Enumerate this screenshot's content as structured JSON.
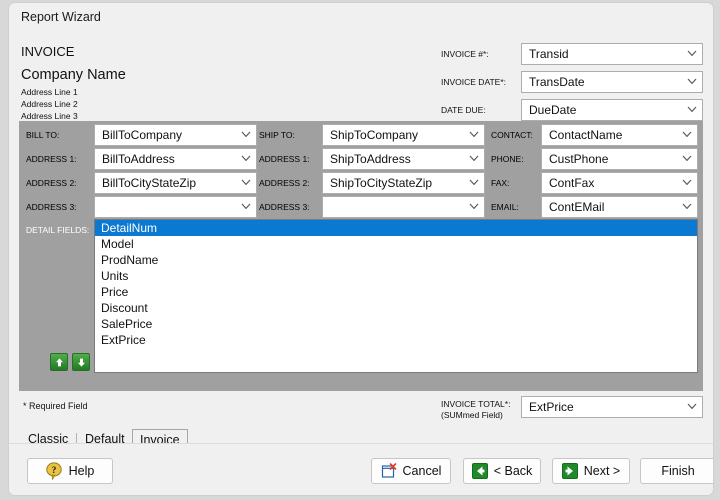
{
  "window": {
    "title": "Report Wizard"
  },
  "header": {
    "invoice_label": "INVOICE",
    "company_name": "Company Name",
    "address_line_1": "Address Line 1",
    "address_line_2": "Address Line 2",
    "address_line_3": "Address Line 3"
  },
  "top_fields": [
    {
      "label": "INVOICE #*:",
      "value": "Transid"
    },
    {
      "label": "INVOICE DATE*:",
      "value": "TransDate"
    },
    {
      "label": "DATE DUE:",
      "value": "DueDate"
    }
  ],
  "bill_to": [
    {
      "label": "BILL TO:",
      "value": "BillToCompany"
    },
    {
      "label": "ADDRESS 1:",
      "value": "BillToAddress"
    },
    {
      "label": "ADDRESS 2:",
      "value": "BillToCityStateZip"
    },
    {
      "label": "ADDRESS 3:",
      "value": ""
    }
  ],
  "ship_to": [
    {
      "label": "SHIP TO:",
      "value": "ShipToCompany"
    },
    {
      "label": "ADDRESS 1:",
      "value": "ShipToAddress"
    },
    {
      "label": "ADDRESS 2:",
      "value": "ShipToCityStateZip"
    },
    {
      "label": "ADDRESS 3:",
      "value": ""
    }
  ],
  "contact": [
    {
      "label": "CONTACT:",
      "value": "ContactName"
    },
    {
      "label": "PHONE:",
      "value": "CustPhone"
    },
    {
      "label": "FAX:",
      "value": "ContFax"
    },
    {
      "label": "EMAIL:",
      "value": "ContEMail"
    }
  ],
  "detail_fields": {
    "label": "DETAIL FIELDS:",
    "items": [
      "DetailNum",
      "Model",
      "ProdName",
      "Units",
      "Price",
      "Discount",
      "SalePrice",
      "ExtPrice"
    ],
    "selected_index": 0,
    "move_up_icon": "arrow-up-icon",
    "move_down_icon": "arrow-down-icon"
  },
  "invoice_total": {
    "label_line1": "INVOICE TOTAL*:",
    "label_line2": "(SUMmed Field)",
    "value": "ExtPrice"
  },
  "required_note": "* Required Field",
  "tabs": [
    {
      "label": "Classic",
      "active": false
    },
    {
      "label": "Default",
      "active": false
    },
    {
      "label": "Invoice",
      "active": true
    }
  ],
  "footer": {
    "help": "Help",
    "cancel": "Cancel",
    "back": "< Back",
    "next": "Next >",
    "finish": "Finish"
  },
  "colors": {
    "window_bg": "#f0f0f0",
    "panel_gray": "#a0a0a0",
    "selection_blue": "#0b78d1",
    "arrow_green": "#2d8a2d",
    "help_yellow": "#e8c440",
    "cancel_red": "#e03a28",
    "desktop_bg": "#d8d8d8"
  }
}
